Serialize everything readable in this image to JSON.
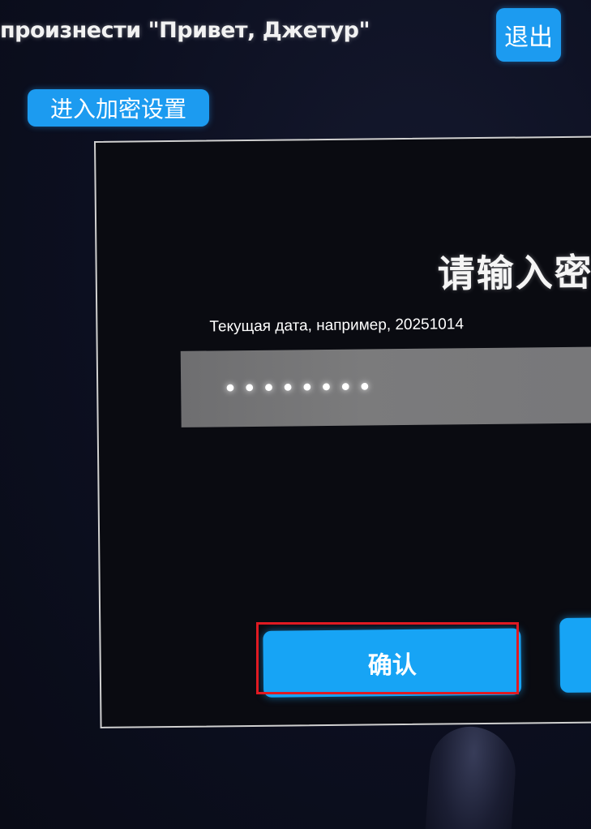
{
  "header": {
    "hint_text": "произнести \"Привет, Джетур\"",
    "exit_label": "退出"
  },
  "encrypt_settings_label": "进入加密设置",
  "dialog": {
    "title": "请输入密码",
    "date_hint": "Текущая дата, например, 20251014",
    "password_masked": "••••••••",
    "confirm_label": "确认"
  },
  "colors": {
    "accent_blue": "#1c9bf0",
    "highlight_red": "#e01a22"
  }
}
